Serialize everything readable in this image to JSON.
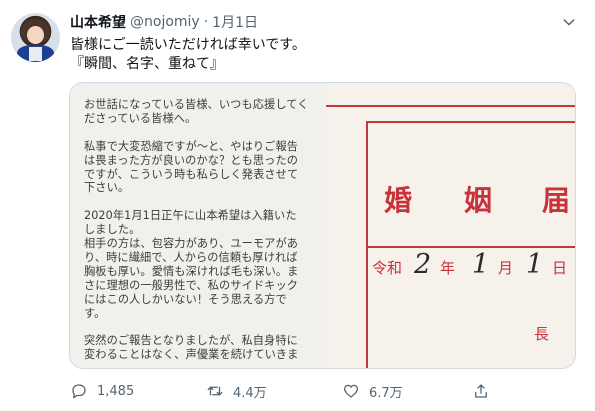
{
  "tweet": {
    "author_name": "山本希望",
    "handle": "@nojomiy",
    "separator": "·",
    "date": "1月1日",
    "text_lines": [
      "皆様にご一読いただければ幸いです。",
      "『瞬間、名字、重ねて』"
    ],
    "note_paragraphs": [
      "お世話になっている皆様、いつも応援してく\nださっている皆様へ。",
      "私事で大変恐縮ですが〜と、やはりご報告\nは畏まった方が良いのかな？とも思ったの\nですが、こういう時も私らしく発表させて\n下さい。",
      "2020年1月1日正午に山本希望は入籍いた\nしました。\n相手の方は、包容力があり、ユーモアがあ\nり、時に繊細で、人からの信頼も厚ければ\n胸板も厚い。愛情も深ければ毛も深い。ま\nさに理想の一般男性で、私のサイドキック\nにはこの人しかいない！そう思える方で\nす。",
      "突然のご報告となりましたが、私自身特に\n変わることはなく、声優業を続けていきま"
    ],
    "form": {
      "title_chars": [
        "婚",
        "姻",
        "届"
      ],
      "era_label": "令和",
      "year_hand": "2",
      "year_label": "年",
      "month_hand": "1",
      "month_label": "月",
      "day_hand": "1",
      "day_label": "日",
      "bottom_label": "長"
    },
    "actions": {
      "replies": "1,485",
      "retweets": "4.4万",
      "likes": "6.7万"
    }
  },
  "colors": {
    "text_primary": "#0f1419",
    "text_secondary": "#536471",
    "form_red": "#c8323a"
  }
}
